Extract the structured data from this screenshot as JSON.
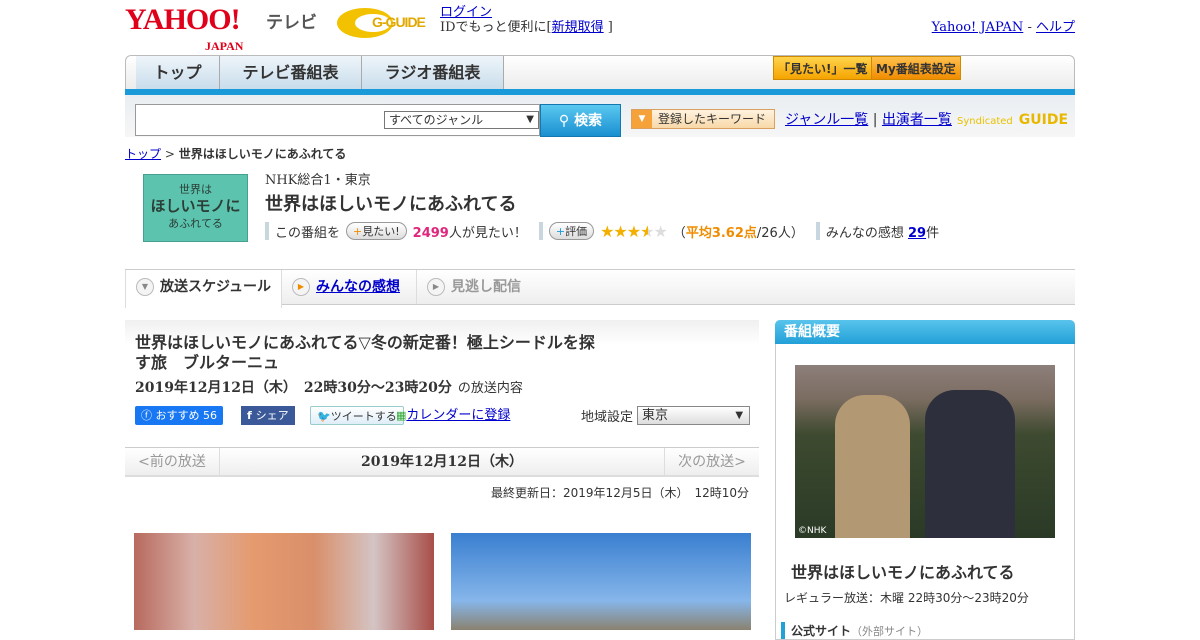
{
  "header": {
    "logo_text": "YAHOO!",
    "logo_sub": "JAPAN",
    "service": "テレビ",
    "gguide": "G-GUIDE",
    "login": "ログイン",
    "id_text": "IDでもっと便利に[",
    "signup": "新規取得",
    "id_close": "]",
    "yahoo_japan": "Yahoo! JAPAN",
    "sep": "-",
    "help": "ヘルプ"
  },
  "nav": {
    "tabs": [
      "トップ",
      "テレビ番組表",
      "ラジオ番組表"
    ],
    "mitai_list": "「見たい!」一覧",
    "my_settings": "My番組表設定"
  },
  "search": {
    "value": "",
    "genre": "すべてのジャンル",
    "button": "検索",
    "keyword_btn": "登録したキーワード",
    "genre_list": "ジャンル一覧",
    "performer_list": "出演者一覧",
    "syndicated": "Syndicated",
    "gguide": "GUIDE"
  },
  "breadcrumb": {
    "top": "トップ",
    "sep": ">",
    "current": "世界はほしいモノにあふれてる"
  },
  "program": {
    "thumb_lines": [
      "世界は",
      "ほしいモノに",
      "あふれてる"
    ],
    "station": "NHK総合1・東京",
    "title": "世界はほしいモノにあふれてる",
    "watch_prefix": "この番組を",
    "watch_btn": "見たい!",
    "watch_count": "2499",
    "watch_suffix": "人が見たい！",
    "rate_btn": "評価",
    "rating": 3.62,
    "rating_open": "（",
    "rating_avg": "平均3.62点",
    "rating_count": "/26人）",
    "reviews_label": "みんなの感想",
    "reviews_count": "29",
    "reviews_suffix": "件"
  },
  "tabs": [
    {
      "label": "放送スケジュール"
    },
    {
      "label": "みんなの感想"
    },
    {
      "label": "見逃し配信"
    }
  ],
  "episode": {
    "title": "世界はほしいモノにあふれてる▽冬の新定番！極上シードルを探す旅　ブルターニュ",
    "date": "2019年12月12日（木）　22時30分～23時20分",
    "date_suffix": "の放送内容",
    "fb_like": "おすすめ 56",
    "fb_share": "シェア",
    "tweet": "ツイートする",
    "calendar": "カレンダーに登録",
    "region_label": "地域設定",
    "region": "東京"
  },
  "pager": {
    "prev": "<前の放送",
    "current": "2019年12月12日（木）",
    "next": "次の放送>"
  },
  "updated": "最終更新日：2019年12月5日（木）　12時10分",
  "sidebar": {
    "header": "番組概要",
    "credit": "©NHK",
    "title": "世界はほしいモノにあふれてる",
    "regular": "レギュラー放送：木曜 22時30分～23時20分",
    "official": "公式サイト",
    "official_note": "（外部サイト）"
  }
}
